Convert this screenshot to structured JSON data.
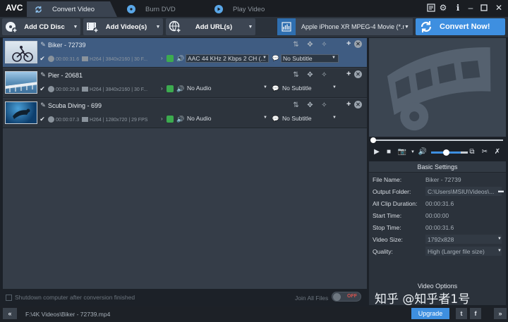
{
  "app": {
    "logo": "AVC"
  },
  "tabs": [
    {
      "label": "Convert Video",
      "active": true
    },
    {
      "label": "Burn DVD",
      "active": false
    },
    {
      "label": "Play Video",
      "active": false
    }
  ],
  "window_icons": [
    "registration-icon",
    "settings-gear-icon",
    "info-icon",
    "minimize-icon",
    "maximize-icon",
    "close-icon"
  ],
  "toolbar": {
    "add_cd": "Add CD Disc",
    "add_video": "Add Video(s)",
    "add_url": "Add URL(s)",
    "profile": "Apple iPhone XR MPEG-4 Movie (*.m...",
    "convert": "Convert Now!"
  },
  "files": [
    {
      "name": "Biker - 72739",
      "duration": "00:00:31.6",
      "codec": "H264",
      "resolution": "3840x2160",
      "fps": "30 F...",
      "audio": "AAC 44 KHz 2 Kbps 2 CH (...",
      "subtitle": "No Subtitle",
      "selected": true
    },
    {
      "name": "Pier - 20681",
      "duration": "00:00:29.8",
      "codec": "H264",
      "resolution": "3840x2160",
      "fps": "30 F...",
      "audio": "No Audio",
      "subtitle": "No Subtitle",
      "selected": false
    },
    {
      "name": "Scuba Diving - 699",
      "duration": "00:00:07.3",
      "codec": "H264",
      "resolution": "1280x720",
      "fps": "29 FPS",
      "audio": "No Audio",
      "subtitle": "No Subtitle",
      "selected": false
    }
  ],
  "bottom": {
    "shutdown": "Shutdown computer after conversion finished",
    "join": "Join All Files",
    "toggle": "OFF"
  },
  "settings": {
    "title": "Basic Settings",
    "rows": [
      {
        "key": "File Name:",
        "value": "Biker - 72739"
      },
      {
        "key": "Output Folder:",
        "value": "C:\\Users\\MSIU\\Videos\\..."
      },
      {
        "key": "All Clip Duration:",
        "value": "00:00:31.6"
      },
      {
        "key": "Start Time:",
        "value": "00:00:00"
      },
      {
        "key": "Stop Time:",
        "value": "00:00:31.6"
      },
      {
        "key": "Video Size:",
        "value": "1792x828"
      },
      {
        "key": "Quality:",
        "value": "High (Larger file size)"
      }
    ],
    "video_options": "Video Options"
  },
  "status": {
    "path": "F:\\4K Videos\\Biker - 72739.mp4",
    "upgrade": "Upgrade",
    "watermark": "知乎 @知乎者1号"
  },
  "colors": {
    "accent": "#3e8fe0",
    "selected_row": "#3f5c82",
    "toggle_off": "#d8544f"
  }
}
